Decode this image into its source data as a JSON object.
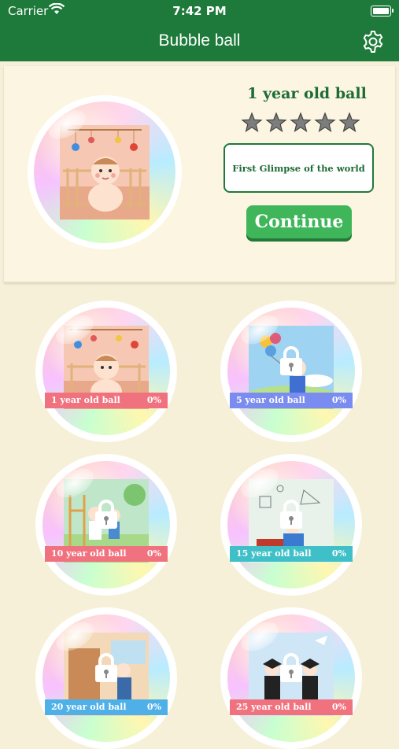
{
  "status": {
    "carrier": "Carrier",
    "time": "7:42 PM"
  },
  "header": {
    "title": "Bubble ball"
  },
  "featured": {
    "name": "1 year old ball",
    "stars_total": 5,
    "description": "First Glimpse of the world",
    "continue_label": "Continue"
  },
  "levels": [
    {
      "name": "1 year old ball",
      "progress": "0%",
      "locked": false,
      "band_color": "#f0727e"
    },
    {
      "name": "5 year old ball",
      "progress": "0%",
      "locked": true,
      "band_color": "#7b8cf0"
    },
    {
      "name": "10 year old ball",
      "progress": "0%",
      "locked": true,
      "band_color": "#f0727e"
    },
    {
      "name": "15 year old ball",
      "progress": "0%",
      "locked": true,
      "band_color": "#3fc0c8"
    },
    {
      "name": "20 year old ball",
      "progress": "0%",
      "locked": true,
      "band_color": "#4fb0e8"
    },
    {
      "name": "25 year old ball",
      "progress": "0%",
      "locked": true,
      "band_color": "#f0727e"
    }
  ],
  "colors": {
    "header": "#1e7a3a",
    "accent": "#3fb65a",
    "background": "#f7f0d8"
  }
}
